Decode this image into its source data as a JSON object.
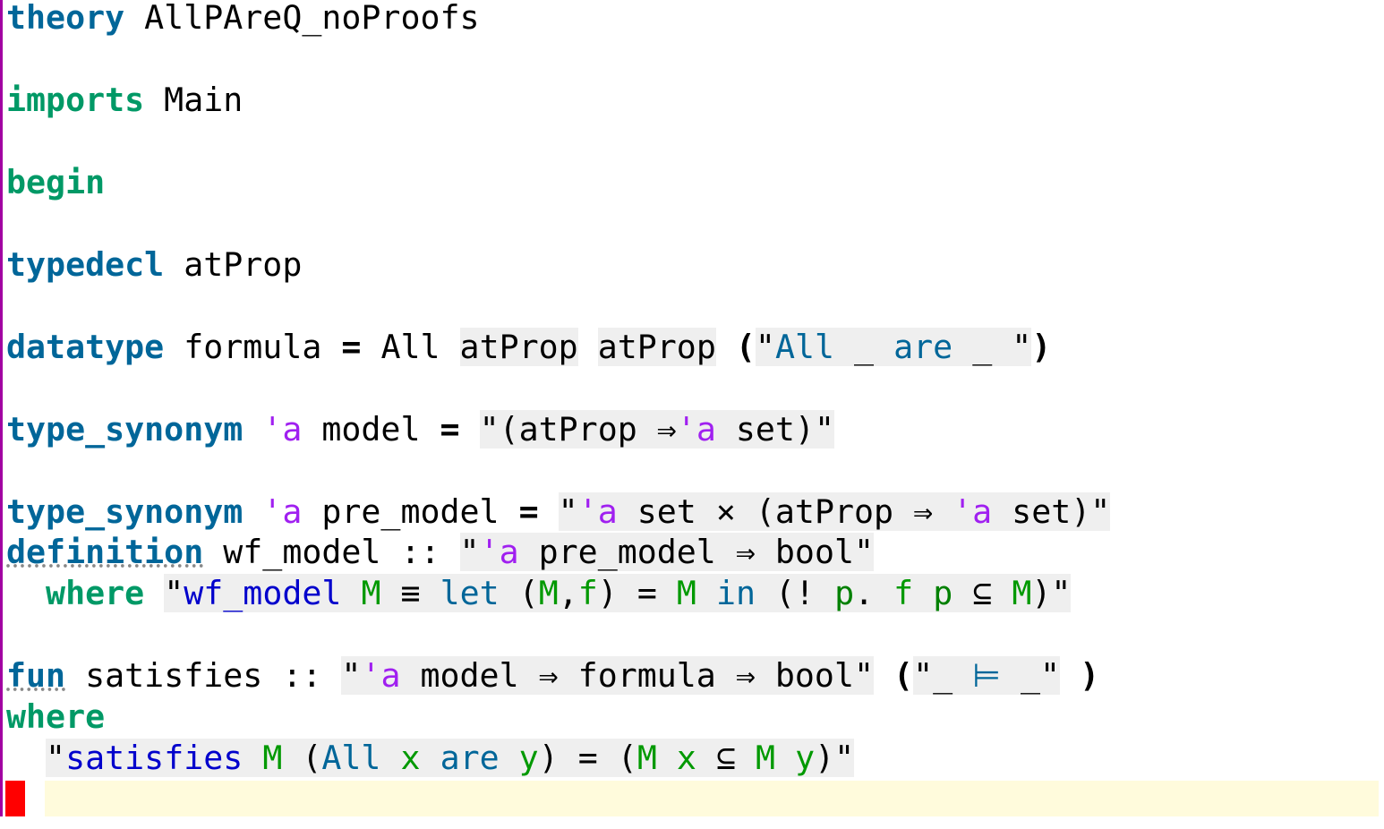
{
  "editor": {
    "line1": {
      "kw": "theory",
      "name": " AllPAreQ_noProofs"
    },
    "line2": {
      "kw": "imports",
      "name": " Main"
    },
    "line3": {
      "kw": "begin"
    },
    "line4": {
      "kw": "typedecl",
      "name": " atProp"
    },
    "line5": {
      "kw": "datatype",
      "t1": " formula ",
      "eq": "=",
      "t2": " All ",
      "a1": "atProp",
      "a2": "atProp",
      "p1": "(",
      "q1": "\"",
      "m1": "All",
      "m2": " _ ",
      "m3": "are",
      "m4": " _ ",
      "q2": "\"",
      "p2": ")"
    },
    "line6": {
      "kw": "type_synonym",
      "tv": "'a",
      "t1": " model ",
      "eq": "=",
      "s1": "\"(atProp ⇒",
      "tv2": "'a",
      "s2": " set)\""
    },
    "line7": {
      "kw": "type_synonym",
      "tv": "'a",
      "t1": " pre_model ",
      "eq": "=",
      "s0": "\"",
      "tv2": "'a",
      "s1": " set × (atProp ⇒ ",
      "tv3": "'a",
      "s2": " set)\""
    },
    "line8": {
      "kw": "definition",
      "t1": " wf_model :: ",
      "s0": "\"",
      "tv": "'a",
      "s1": " pre_model ⇒ bool\""
    },
    "line9": {
      "kw": "where",
      "q0": "\"",
      "c1": "wf_model",
      "v1": "M",
      "e1": " ≡ ",
      "lt": "let",
      "p1": " (",
      "v2": "M",
      "cm": ",",
      "v3": "f",
      "p2": ") = ",
      "v4": "M",
      "in": "in",
      "p3": " (! ",
      "b1": "p",
      "d1": ". ",
      "v5": "f",
      "b2": "p",
      "sb": " ⊆ ",
      "v6": "M",
      "p4": ")\""
    },
    "line10": {
      "kw": "fun",
      "t1": " satisfies :: ",
      "s0": "\"",
      "tv": "'a",
      "s1": " model ⇒ formula ⇒ bool\"",
      "p1": "(",
      "q1": "\"_ ",
      "m1": "⊨",
      "q2": " _\"",
      "p2": ")"
    },
    "line11": {
      "kw": "where"
    },
    "line12": {
      "q0": "\"",
      "c1": "satisfies",
      "v1": "M",
      "p1": " (",
      "m1": "All",
      "b1": "x",
      "m2": "are",
      "b2": "y",
      "p2": ") = (",
      "v2": "M",
      "b3": "x",
      "sb": " ⊆ ",
      "v3": "M",
      "b4": "y",
      "p3": ")\""
    }
  },
  "colors": {
    "keyword_blue": "#006699",
    "keyword_green": "#009966",
    "type_var": "#a020f0",
    "const": "#0000cc",
    "free_var": "#009900",
    "cursor": "#ff0000",
    "current_line": "#fffbdc"
  }
}
